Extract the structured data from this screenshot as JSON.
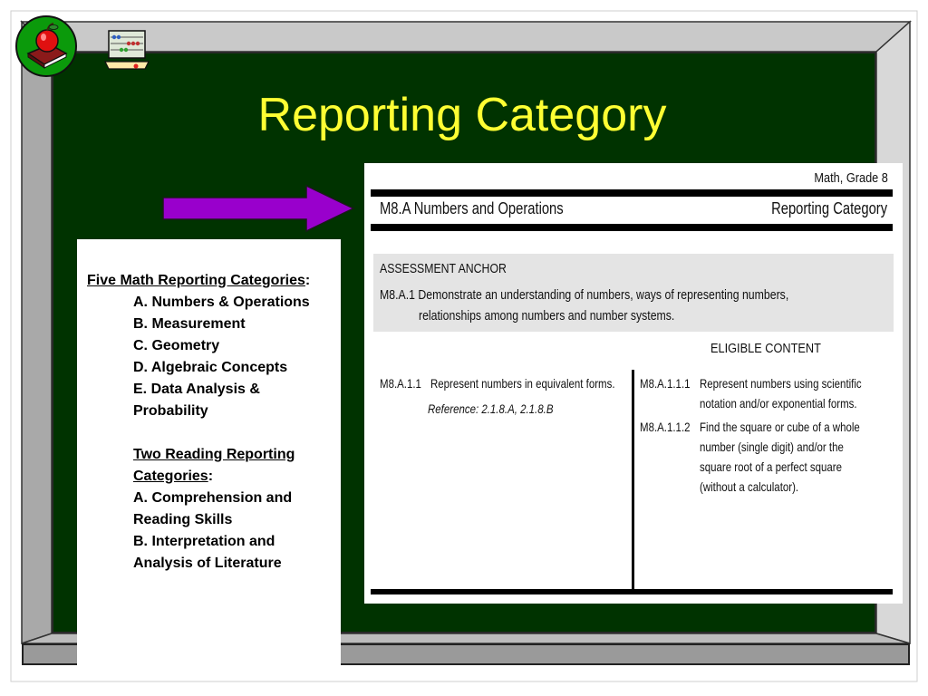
{
  "slide": {
    "title": "Reporting Category",
    "colors": {
      "board": "#003300",
      "title": "#ffff33",
      "arrow": "#9900cc",
      "badge": "#0b9a0b"
    },
    "icons": [
      "apple-on-book-icon",
      "abacus-icon",
      "arrow-right-icon"
    ]
  },
  "left_panel": {
    "math_heading": "Five Math Reporting Categories",
    "colon": ":",
    "math_items": [
      "A. Numbers & Operations",
      "B. Measurement",
      "C. Geometry",
      "D. Algebraic Concepts",
      "E. Data Analysis & Probability"
    ],
    "reading_heading": "Two Reading Reporting Categories",
    "reading_items": [
      "A. Comprehension and Reading Skills",
      "B. Interpretation and Analysis of Literature"
    ]
  },
  "document": {
    "grade": "Math, Grade 8",
    "section": "M8.A Numbers and Operations",
    "section_tag": "Reporting Category",
    "anchor_heading": "ASSESSMENT ANCHOR",
    "anchor_line1": "M8.A.1 Demonstrate an understanding of numbers, ways of representing numbers,",
    "anchor_line2": "relationships among numbers and number systems.",
    "eligible_heading": "ELIGIBLE CONTENT",
    "descriptor_code": "M8.A.1.1",
    "descriptor_text": "Represent numbers in equivalent forms.",
    "descriptor_ref": "Reference: 2.1.8.A, 2.1.8.B",
    "eligible": [
      {
        "code": "M8.A.1.1.1",
        "lines": [
          "Represent numbers using scientific",
          "notation and/or exponential forms."
        ]
      },
      {
        "code": "M8.A.1.1.2",
        "lines": [
          "Find the square or cube of a whole",
          "number (single digit) and/or the",
          "square root of a perfect square",
          "(without a calculator)."
        ]
      }
    ]
  }
}
